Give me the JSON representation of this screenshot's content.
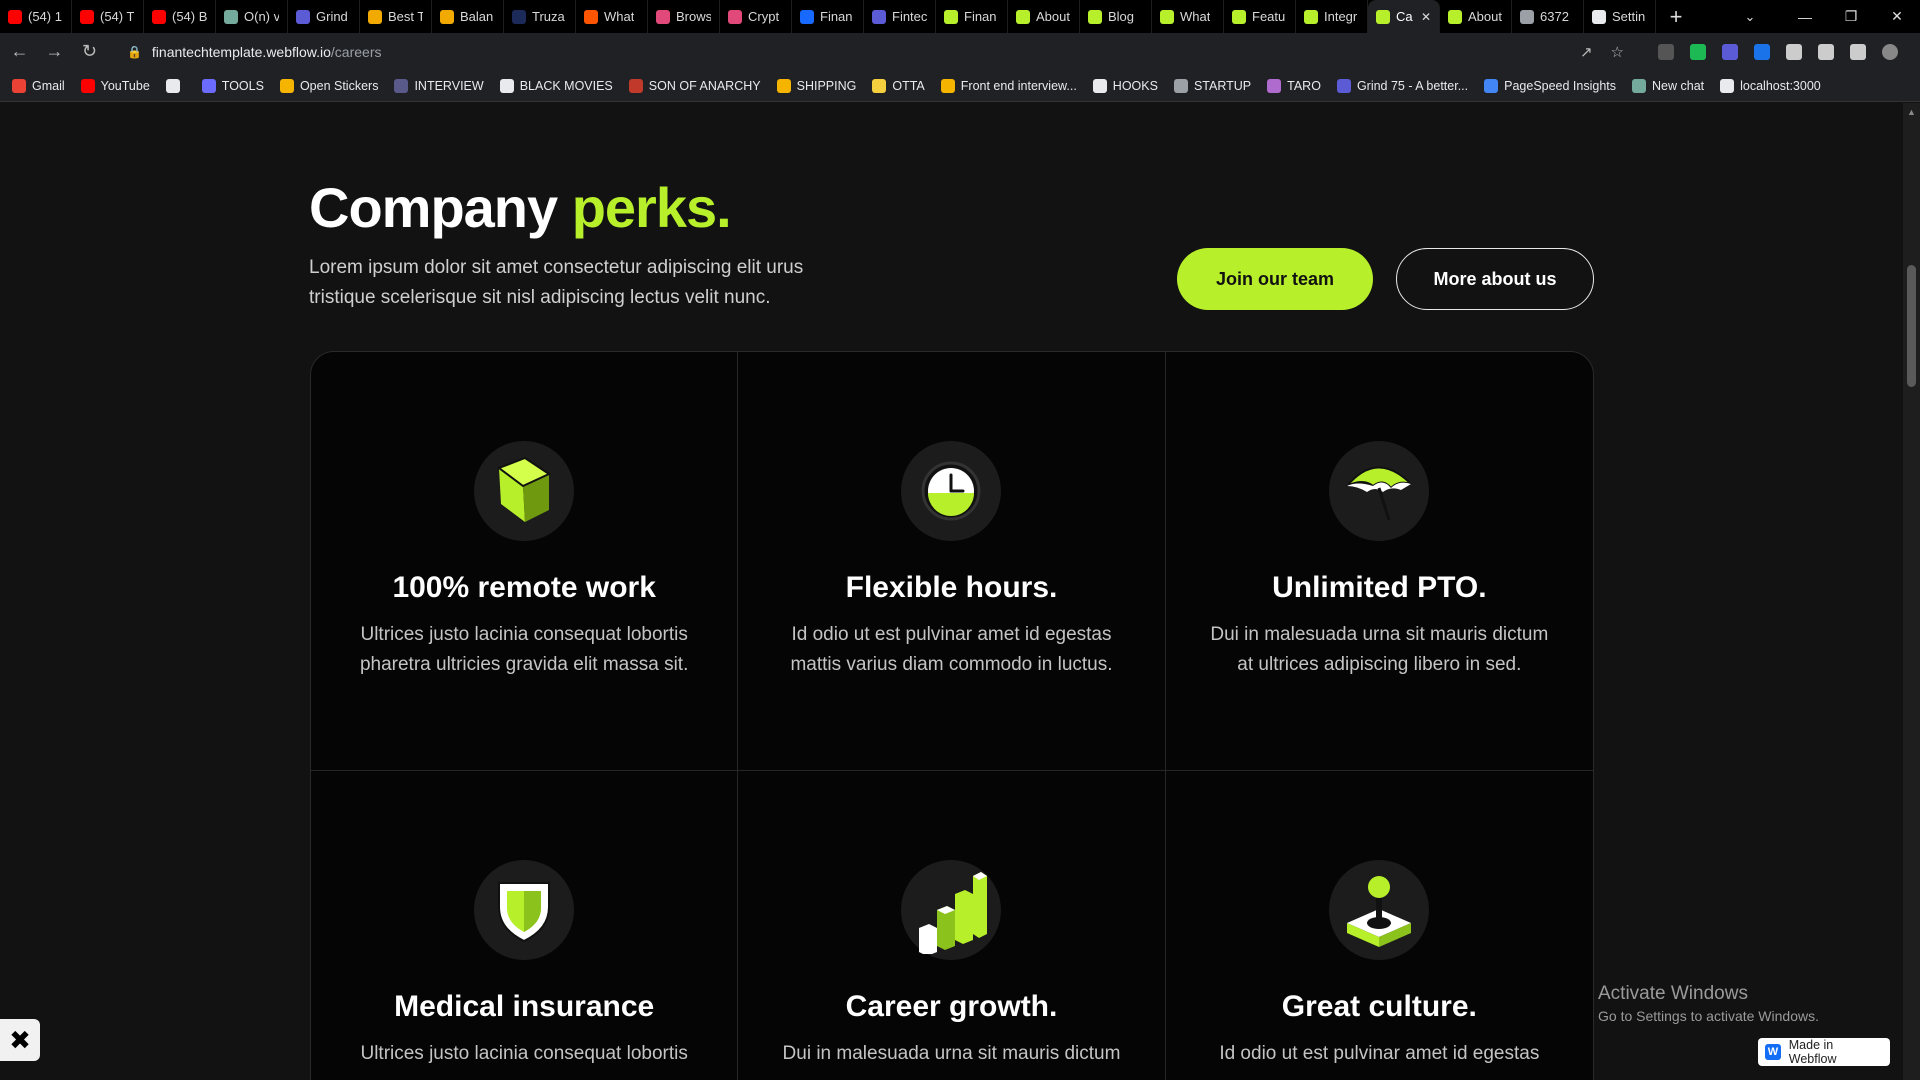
{
  "browser": {
    "tabs": [
      {
        "title": "(54) 1",
        "color": "#ff0000"
      },
      {
        "title": "(54) T",
        "color": "#ff0000"
      },
      {
        "title": "(54) B",
        "color": "#ff0000"
      },
      {
        "title": "O(n) v",
        "color": "#74aa9c"
      },
      {
        "title": "Grind",
        "color": "#5b5bd6"
      },
      {
        "title": "Best T",
        "color": "#f2a900"
      },
      {
        "title": "Balan",
        "color": "#f2a900"
      },
      {
        "title": "Truza",
        "color": "#1c2a5a"
      },
      {
        "title": "What",
        "color": "#ff5500"
      },
      {
        "title": "Brows",
        "color": "#e0497a"
      },
      {
        "title": "Crypt",
        "color": "#e0497a"
      },
      {
        "title": "Finan",
        "color": "#1769ff"
      },
      {
        "title": "Fintec",
        "color": "#5b5bd6"
      },
      {
        "title": "Finan",
        "color": "#b7ef2b"
      },
      {
        "title": "About",
        "color": "#b7ef2b"
      },
      {
        "title": "Blog",
        "color": "#b7ef2b"
      },
      {
        "title": "What",
        "color": "#b7ef2b"
      },
      {
        "title": "Featu",
        "color": "#b7ef2b"
      },
      {
        "title": "Integr",
        "color": "#b7ef2b"
      },
      {
        "title": "Ca",
        "color": "#b7ef2b",
        "active": true
      },
      {
        "title": "About",
        "color": "#b7ef2b"
      },
      {
        "title": "6372",
        "color": "#9aa0a6"
      },
      {
        "title": "Settin",
        "color": "#e8eaed"
      }
    ],
    "new_tab": "+",
    "url_host": "finantechtemplate.webflow.io",
    "url_path": "/careers",
    "bookmarks": [
      {
        "label": "Gmail",
        "color": "#ea4335"
      },
      {
        "label": "YouTube",
        "color": "#ff0000"
      },
      {
        "label": "",
        "color": "#e8eaed"
      },
      {
        "label": "TOOLS",
        "color": "#6b6bff"
      },
      {
        "label": "Open Stickers",
        "color": "#f4b400"
      },
      {
        "label": "INTERVIEW",
        "color": "#5a5a8a"
      },
      {
        "label": "BLACK MOVIES",
        "color": "#e8eaed"
      },
      {
        "label": "SON OF ANARCHY",
        "color": "#c0392b"
      },
      {
        "label": "SHIPPING",
        "color": "#f4b400"
      },
      {
        "label": "OTTA",
        "color": "#f4d03f"
      },
      {
        "label": "Front end interview...",
        "color": "#f4b400"
      },
      {
        "label": "HOOKS",
        "color": "#e8eaed"
      },
      {
        "label": "STARTUP",
        "color": "#9aa0a6"
      },
      {
        "label": "TARO",
        "color": "#b06bcf"
      },
      {
        "label": "Grind 75 - A better...",
        "color": "#5b5bd6"
      },
      {
        "label": "PageSpeed Insights",
        "color": "#4285f4"
      },
      {
        "label": "New chat",
        "color": "#74aa9c"
      },
      {
        "label": "localhost:3000",
        "color": "#e8eaed"
      }
    ]
  },
  "section": {
    "title_main": "Company ",
    "title_accent": "perks.",
    "description": "Lorem ipsum dolor sit amet consectetur adipiscing elit urus tristique scelerisque sit nisl adipiscing lectus velit nunc.",
    "primary_button": "Join our team",
    "secondary_button": "More about us"
  },
  "perks": [
    {
      "title": "100% remote work",
      "desc": "Ultrices justo lacinia consequat lobortis pharetra ultricies gravida elit massa sit.",
      "icon": "box-icon"
    },
    {
      "title": "Flexible hours.",
      "desc": "Id odio ut est pulvinar amet id egestas mattis varius diam commodo in luctus.",
      "icon": "clock-icon"
    },
    {
      "title": "Unlimited PTO.",
      "desc": "Dui in malesuada urna sit mauris dictum at ultrices adipiscing libero in sed.",
      "icon": "umbrella-icon"
    },
    {
      "title": "Medical insurance",
      "desc": "Ultrices justo lacinia consequat lobortis",
      "icon": "shield-icon"
    },
    {
      "title": "Career growth.",
      "desc": "Dui in malesuada urna sit mauris dictum",
      "icon": "growth-chart-icon"
    },
    {
      "title": "Great culture.",
      "desc": "Id odio ut est pulvinar amet id egestas",
      "icon": "joystick-icon"
    }
  ],
  "os": {
    "activate_title": "Activate Windows",
    "activate_sub": "Go to Settings to activate Windows."
  },
  "badge": {
    "label": "Made in Webflow"
  },
  "colors": {
    "accent": "#b7ef2b",
    "background": "#121212",
    "card": "#050505"
  }
}
